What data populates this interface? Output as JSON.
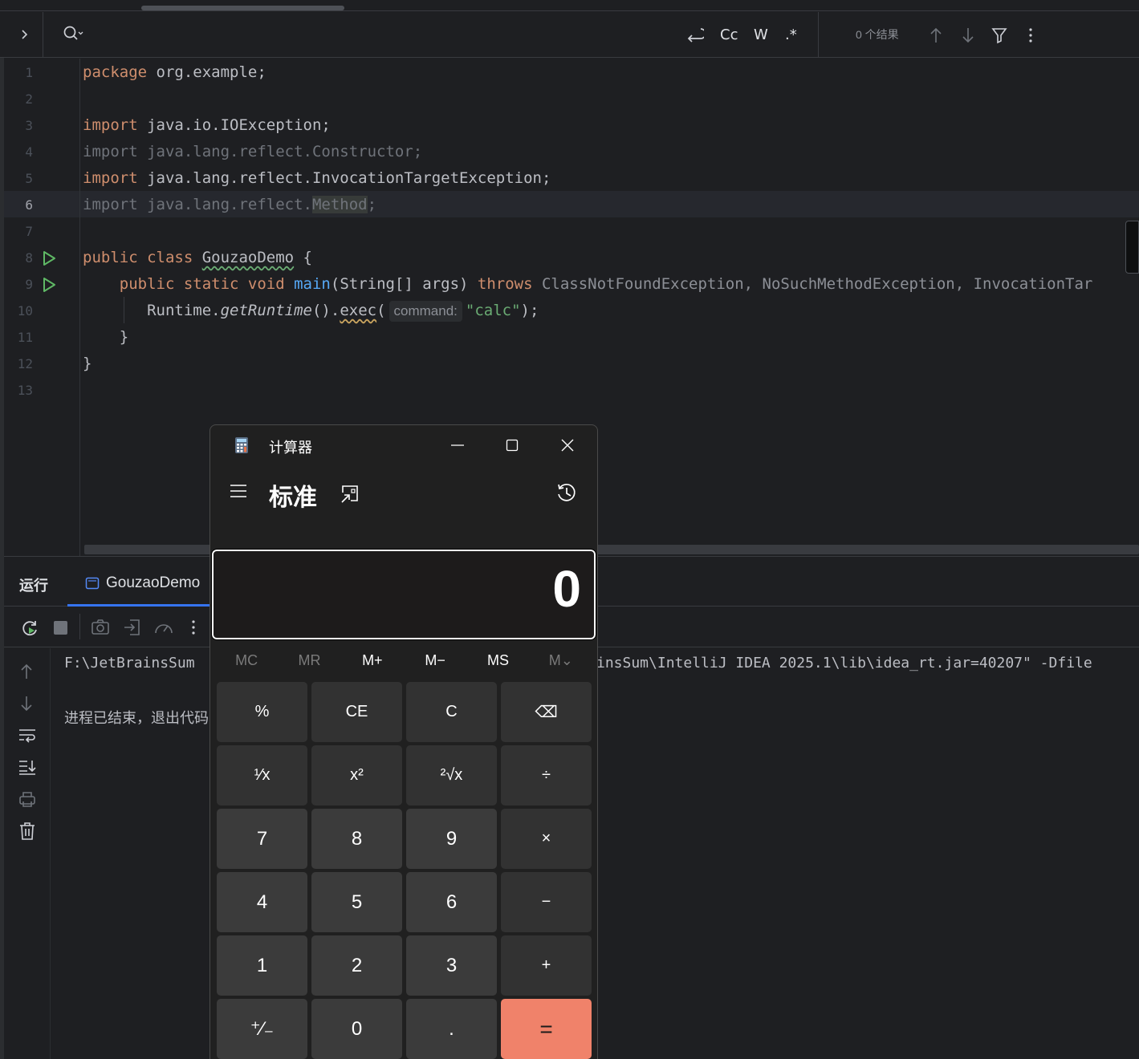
{
  "search": {
    "options": [
      "Cc",
      "W",
      ".*"
    ],
    "results": "0 个结果"
  },
  "editor": {
    "line_numbers": [
      "1",
      "2",
      "3",
      "4",
      "5",
      "6",
      "7",
      "8",
      "9",
      "10",
      "11",
      "12",
      "13"
    ],
    "current_line": "6",
    "lines": {
      "l1_kw": "package",
      "l1_rest": " org.example;",
      "l3_kw": "import",
      "l3_rest": " java.io.IOException;",
      "l4": "import java.lang.reflect.Constructor;",
      "l5_kw": "import",
      "l5_rest": " java.lang.reflect.InvocationTargetException;",
      "l6_a": "import java.lang.reflect.",
      "l6_b": "Method",
      "l6_c": ";",
      "l8_kw": "public class ",
      "l8_name": "GouzaoDemo",
      "l8_rest": " {",
      "l9_indent": "    ",
      "l9_kw": "public static void ",
      "l9_fn": "main",
      "l9_args": "(String[] args) ",
      "l9_throws": "throws ",
      "l9_exc": "ClassNotFoundException, NoSuchMethodException, InvocationTar",
      "l10_indent": "       ",
      "l10_a": "Runtime.",
      "l10_b": "getRuntime",
      "l10_c": "().",
      "l10_d": "exec",
      "l10_e": "(",
      "l10_hint": "command:",
      "l10_str": "\"calc\"",
      "l10_end": ");",
      "l11": "    }",
      "l12": "}"
    }
  },
  "run_panel": {
    "title": "运行",
    "tab_label": "GouzaoDemo",
    "console_line1_left": "F:\\JetBrainsSum",
    "console_line1_right": "insSum\\IntelliJ IDEA 2025.1\\lib\\idea_rt.jar=40207\" -Dfile",
    "console_line2": "进程已结束，退出代码"
  },
  "calculator": {
    "title": "计算器",
    "mode": "标准",
    "display": "0",
    "memory": [
      "MC",
      "MR",
      "M+",
      "M−",
      "MS",
      "M⌄"
    ],
    "keys": [
      [
        "%",
        "CE",
        "C",
        "⌫"
      ],
      [
        "¹⁄x",
        "x²",
        "²√x",
        "÷"
      ],
      [
        "7",
        "8",
        "9",
        "×"
      ],
      [
        "4",
        "5",
        "6",
        "−"
      ],
      [
        "1",
        "2",
        "3",
        "+"
      ],
      [
        "⁺⁄₋",
        "0",
        ".",
        "="
      ]
    ],
    "accent": "#f0826a"
  }
}
